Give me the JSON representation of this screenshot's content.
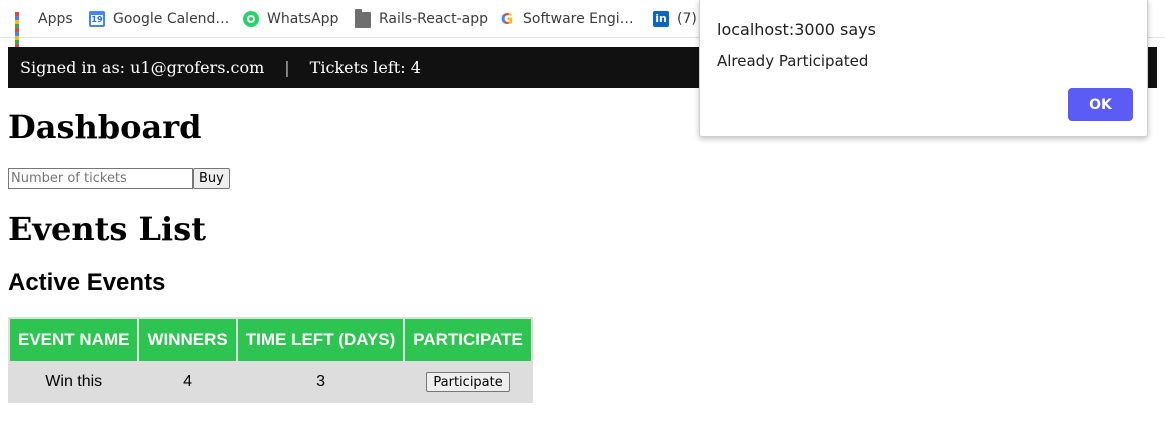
{
  "bookmarks": [
    {
      "label": "Apps",
      "icon": "apps-grid-icon"
    },
    {
      "label": "Google Calend…",
      "icon": "google-calendar-icon"
    },
    {
      "label": "WhatsApp",
      "icon": "whatsapp-icon"
    },
    {
      "label": "Rails-React-app",
      "icon": "folder-icon"
    },
    {
      "label": "Software Engi…",
      "icon": "google-icon"
    },
    {
      "label": "(7)",
      "icon": "linkedin-icon"
    }
  ],
  "calendar_icon_day": "19",
  "navbar": {
    "signed_in": "Signed in as: u1@grofers.com",
    "separator": "|",
    "tickets_left": "Tickets left: 4"
  },
  "dashboard": {
    "title": "Dashboard",
    "tickets_placeholder": "Number of tickets",
    "buy_label": "Buy"
  },
  "events": {
    "title": "Events List",
    "active_title": "Active Events",
    "columns": [
      "EVENT NAME",
      "WINNERS",
      "TIME LEFT (DAYS)",
      "PARTICIPATE"
    ],
    "rows": [
      {
        "name": "Win this",
        "winners": "4",
        "time_left": "3",
        "action": "Participate"
      }
    ]
  },
  "alert": {
    "origin": "localhost:3000 says",
    "message": "Already Participated",
    "ok_label": "OK"
  },
  "colors": {
    "navbar_bg": "#111111",
    "table_header": "#2ec451",
    "table_row": "#dddddd",
    "alert_button": "#5b5bf5"
  }
}
